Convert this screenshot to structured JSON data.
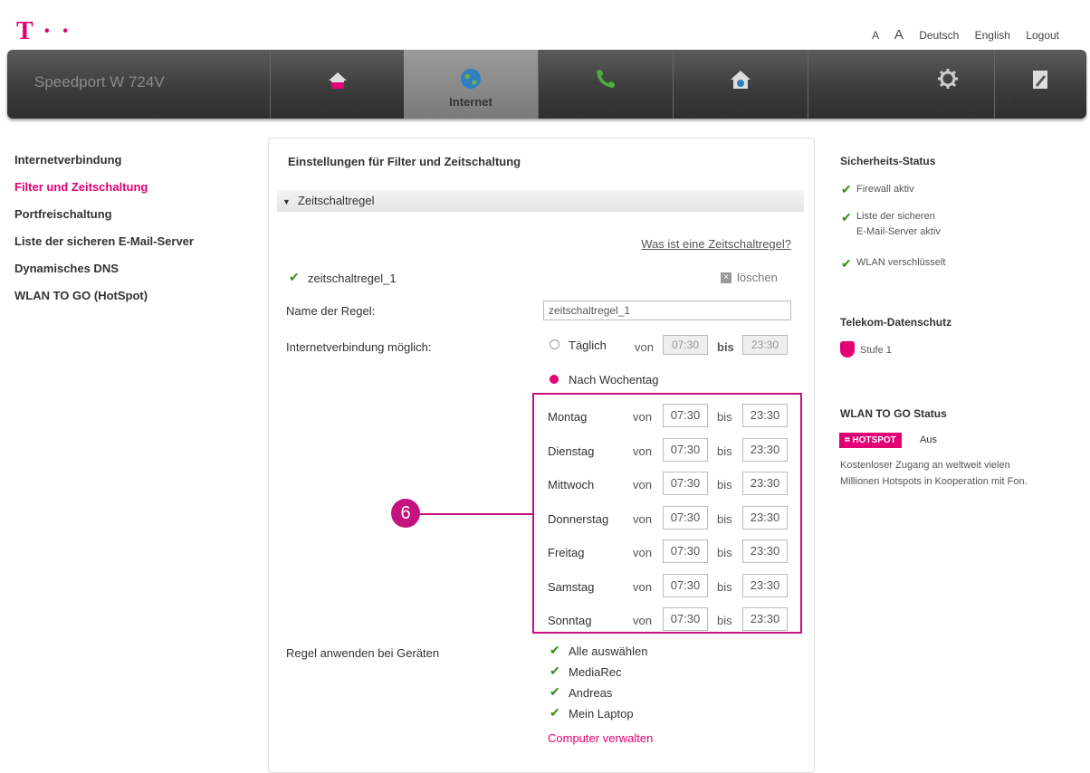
{
  "header": {
    "logo": "T · ·",
    "links": [
      "A",
      "A",
      "Deutsch",
      "English",
      "Logout"
    ]
  },
  "nav": {
    "brand": "Speedport W 724V",
    "items": [
      {
        "label": "Übersicht",
        "icon": "house-icon"
      },
      {
        "label": "Internet",
        "icon": "globe-icon",
        "active": true
      },
      {
        "label": "Telefonie",
        "icon": "phone-icon"
      },
      {
        "label": "Heimnetzwerk",
        "icon": "home-network-icon"
      },
      {
        "label": "Einstellungen",
        "icon": "gear-icon"
      },
      {
        "label": "Handbuch",
        "icon": "book-icon"
      }
    ]
  },
  "sidebar": {
    "items": [
      {
        "label": "Internetverbindung"
      },
      {
        "label": "Filter und Zeitschaltung",
        "selected": true
      },
      {
        "label": "Portfreischaltung"
      },
      {
        "label": "Liste der sicheren E-Mail-Server"
      },
      {
        "label": "Dynamisches DNS"
      },
      {
        "label": "WLAN TO GO (HotSpot)"
      }
    ]
  },
  "main": {
    "title": "Einstellungen für Filter und Zeitschaltung",
    "section": "Zeitschaltregel",
    "help_link": "Was ist eine Zeitschaltregel?",
    "rule_name_check": "zeitschaltregel_1",
    "delete_label": "löschen",
    "name_label": "Name der Regel:",
    "name_value": "zeitschaltregel_1",
    "internet_label": "Internetverbindung möglich:",
    "daily_label": "Täglich",
    "von": "von",
    "bis": "bis",
    "daily_from": "07:30",
    "daily_to": "23:30",
    "weekday_label": "Nach Wochentag",
    "days": [
      {
        "name": "Montag",
        "from": "07:30",
        "to": "23:30"
      },
      {
        "name": "Dienstag",
        "from": "07:30",
        "to": "23:30"
      },
      {
        "name": "Mittwoch",
        "from": "07:30",
        "to": "23:30"
      },
      {
        "name": "Donnerstag",
        "from": "07:30",
        "to": "23:30"
      },
      {
        "name": "Freitag",
        "from": "07:30",
        "to": "23:30"
      },
      {
        "name": "Samstag",
        "from": "07:30",
        "to": "23:30"
      },
      {
        "name": "Sonntag",
        "from": "07:30",
        "to": "23:30"
      }
    ],
    "callout": "6",
    "devices_label": "Regel anwenden bei Geräten",
    "devices": [
      "Alle auswählen",
      "MediaRec",
      "Andreas",
      "Mein Laptop"
    ],
    "manage_link": "Computer verwalten"
  },
  "right": {
    "security_title": "Sicherheits-Status",
    "security_items": [
      "Firewall aktiv",
      "Liste der sicheren",
      "E-Mail-Server aktiv",
      "WLAN verschlüsselt"
    ],
    "privacy_title": "Telekom-Datenschutz",
    "privacy_level": "Stufe 1",
    "wlan_title": "WLAN TO GO Status",
    "hotspot_badge": "HOTSPOT",
    "hotspot_state": "Aus",
    "wlan_text_1": "Kostenloser Zugang an weltweit vielen",
    "wlan_text_2": "Millionen Hotspots in Kooperation mit Fon."
  },
  "colors": {
    "accent": "#e20074",
    "callout": "#c4127e",
    "check": "#3a8b19"
  }
}
